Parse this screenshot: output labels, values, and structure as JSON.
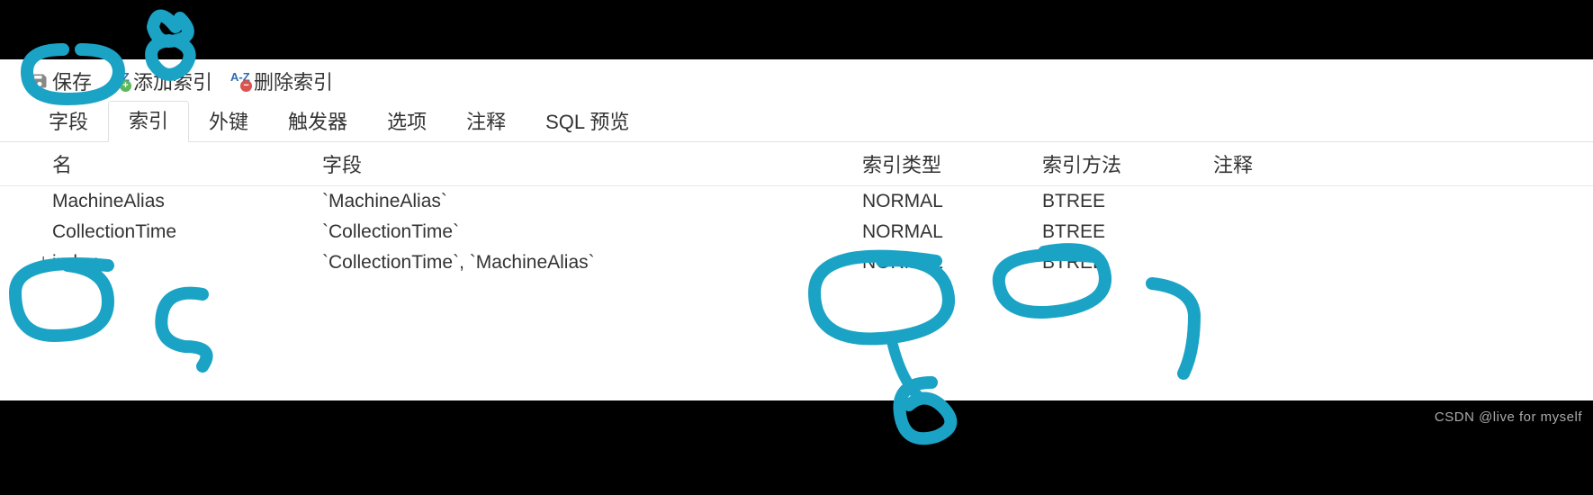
{
  "toolbar": {
    "save_label": "保存",
    "add_index_label": "添加索引",
    "delete_index_label": "删除索引"
  },
  "tabs": {
    "fields": "字段",
    "index": "索引",
    "foreign_key": "外键",
    "trigger": "触发器",
    "options": "选项",
    "comment": "注释",
    "sql_preview": "SQL 预览"
  },
  "columns": {
    "name": "名",
    "fields": "字段",
    "index_type": "索引类型",
    "index_method": "索引方法",
    "comment": "注释"
  },
  "rows": [
    {
      "name": "MachineAlias",
      "fields": "`MachineAlias`",
      "index_type": "NORMAL",
      "index_method": "BTREE",
      "comment": ""
    },
    {
      "name": "CollectionTime",
      "fields": "`CollectionTime`",
      "index_type": "NORMAL",
      "index_method": "BTREE",
      "comment": ""
    },
    {
      "name": "index",
      "fields": "`CollectionTime`, `MachineAlias`",
      "index_type": "NORMAL",
      "index_method": "BTREE",
      "comment": ""
    }
  ],
  "watermark": "CSDN @live for myself",
  "annotations": {
    "labels": [
      "5",
      "6",
      "7",
      "8"
    ]
  }
}
